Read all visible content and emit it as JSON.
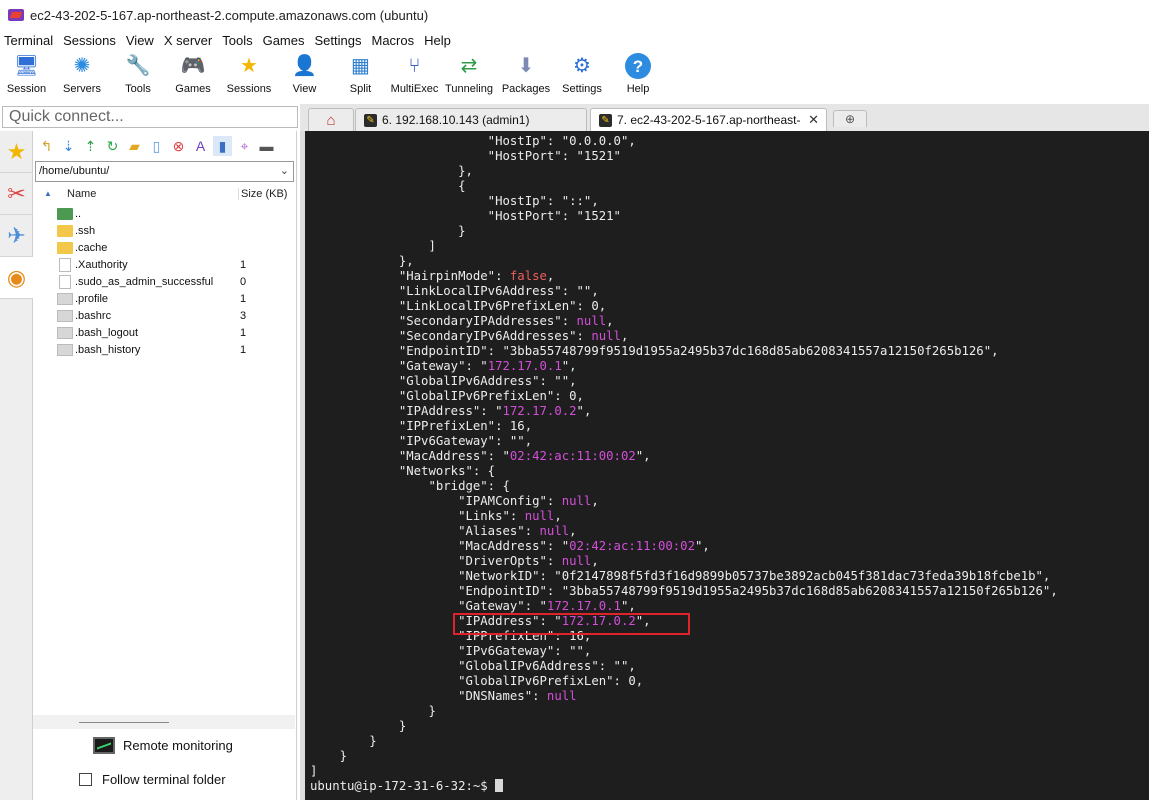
{
  "window": {
    "title": "ec2-43-202-5-167.ap-northeast-2.compute.amazonaws.com (ubuntu)"
  },
  "menu": [
    "Terminal",
    "Sessions",
    "View",
    "X server",
    "Tools",
    "Games",
    "Settings",
    "Macros",
    "Help"
  ],
  "toolbar": [
    {
      "label": "Session",
      "icon": "session-icon",
      "glyph": "🖥",
      "color": "#2f6fd6"
    },
    {
      "label": "Servers",
      "icon": "servers-icon",
      "glyph": "✺",
      "color": "#2b8be0"
    },
    {
      "label": "Tools",
      "icon": "tools-icon",
      "glyph": "🔧",
      "color": "#d33"
    },
    {
      "label": "Games",
      "icon": "games-icon",
      "glyph": "🎮",
      "color": "#555"
    },
    {
      "label": "Sessions",
      "icon": "star-icon",
      "glyph": "★",
      "color": "#f2b705"
    },
    {
      "label": "View",
      "icon": "view-icon",
      "glyph": "👤",
      "color": "#444"
    },
    {
      "label": "Split",
      "icon": "split-icon",
      "glyph": "▦",
      "color": "#2f7fd0"
    },
    {
      "label": "MultiExec",
      "icon": "multiexec-icon",
      "glyph": "⑂",
      "color": "#3b5bc4"
    },
    {
      "label": "Tunneling",
      "icon": "tunneling-icon",
      "glyph": "⇄",
      "color": "#2f9a4a"
    },
    {
      "label": "Packages",
      "icon": "packages-icon",
      "glyph": "⬇",
      "color": "#7a8ab5"
    },
    {
      "label": "Settings",
      "icon": "gear-icon",
      "glyph": "⚙",
      "color": "#2f6fd6"
    },
    {
      "label": "Help",
      "icon": "help-icon",
      "glyph": "?",
      "color": "#ffffff"
    }
  ],
  "quick_connect": {
    "placeholder": "Quick connect..."
  },
  "tabs": [
    {
      "label": "6. 192.168.10.143 (admin1)"
    },
    {
      "label": "7. ec2-43-202-5-167.ap-northeast-"
    }
  ],
  "browser": {
    "path": "/home/ubuntu/",
    "col_name": "Name",
    "col_size": "Size (KB)",
    "files": [
      {
        "name": "..",
        "size": "",
        "kind": "up"
      },
      {
        "name": ".ssh",
        "size": "",
        "kind": "folder"
      },
      {
        "name": ".cache",
        "size": "",
        "kind": "folder"
      },
      {
        "name": ".Xauthority",
        "size": "1",
        "kind": "doc"
      },
      {
        "name": ".sudo_as_admin_successful",
        "size": "0",
        "kind": "doc"
      },
      {
        "name": ".profile",
        "size": "1",
        "kind": "sh"
      },
      {
        "name": ".bashrc",
        "size": "3",
        "kind": "sh"
      },
      {
        "name": ".bash_logout",
        "size": "1",
        "kind": "sh"
      },
      {
        "name": ".bash_history",
        "size": "1",
        "kind": "sh"
      }
    ],
    "remote_monitoring": "Remote monitoring",
    "follow_folder": "Follow terminal folder"
  },
  "terminal": {
    "lines": [
      [
        [
          "                        \"HostIp\": \"0.0.0.0\",",
          ""
        ]
      ],
      [
        [
          "                        \"HostPort\": \"1521\"",
          ""
        ]
      ],
      [
        [
          "                    },",
          ""
        ]
      ],
      [
        [
          "                    {",
          ""
        ]
      ],
      [
        [
          "                        \"HostIp\": \"::\",",
          ""
        ]
      ],
      [
        [
          "                        \"HostPort\": \"1521\"",
          ""
        ]
      ],
      [
        [
          "                    }",
          ""
        ]
      ],
      [
        [
          "                ]",
          ""
        ]
      ],
      [
        [
          "            },",
          ""
        ]
      ],
      [
        [
          "            \"HairpinMode\": ",
          ""
        ],
        [
          "false",
          "bool"
        ],
        [
          ",",
          ""
        ]
      ],
      [
        [
          "            \"LinkLocalIPv6Address\": \"\",",
          ""
        ]
      ],
      [
        [
          "            \"LinkLocalIPv6PrefixLen\": 0,",
          ""
        ]
      ],
      [
        [
          "            \"SecondaryIPAddresses\": ",
          ""
        ],
        [
          "null",
          "null"
        ],
        [
          ",",
          ""
        ]
      ],
      [
        [
          "            \"SecondaryIPv6Addresses\": ",
          ""
        ],
        [
          "null",
          "null"
        ],
        [
          ",",
          ""
        ]
      ],
      [
        [
          "            \"EndpointID\": \"3bba55748799f9519d1955a2495b37dc168d85ab6208341557a12150f265b126\",",
          ""
        ]
      ],
      [
        [
          "            \"Gateway\": \"",
          ""
        ],
        [
          "172.17.0.1",
          "ip"
        ],
        [
          "\",",
          ""
        ]
      ],
      [
        [
          "            \"GlobalIPv6Address\": \"\",",
          ""
        ]
      ],
      [
        [
          "            \"GlobalIPv6PrefixLen\": 0,",
          ""
        ]
      ],
      [
        [
          "            \"IPAddress\": \"",
          ""
        ],
        [
          "172.17.0.2",
          "ip"
        ],
        [
          "\",",
          ""
        ]
      ],
      [
        [
          "            \"IPPrefixLen\": 16,",
          ""
        ]
      ],
      [
        [
          "            \"IPv6Gateway\": \"\",",
          ""
        ]
      ],
      [
        [
          "            \"MacAddress\": \"",
          ""
        ],
        [
          "02:42:ac:11:00:02",
          "ip"
        ],
        [
          "\",",
          ""
        ]
      ],
      [
        [
          "            \"Networks\": {",
          ""
        ]
      ],
      [
        [
          "                \"bridge\": {",
          ""
        ]
      ],
      [
        [
          "                    \"IPAMConfig\": ",
          ""
        ],
        [
          "null",
          "null"
        ],
        [
          ",",
          ""
        ]
      ],
      [
        [
          "                    \"Links\": ",
          ""
        ],
        [
          "null",
          "null"
        ],
        [
          ",",
          ""
        ]
      ],
      [
        [
          "                    \"Aliases\": ",
          ""
        ],
        [
          "null",
          "null"
        ],
        [
          ",",
          ""
        ]
      ],
      [
        [
          "                    \"MacAddress\": \"",
          ""
        ],
        [
          "02:42:ac:11:00:02",
          "ip"
        ],
        [
          "\",",
          ""
        ]
      ],
      [
        [
          "                    \"DriverOpts\": ",
          ""
        ],
        [
          "null",
          "null"
        ],
        [
          ",",
          ""
        ]
      ],
      [
        [
          "                    \"NetworkID\": \"0f2147898f5fd3f16d9899b05737be3892acb045f381dac73feda39b18fcbe1b\",",
          ""
        ]
      ],
      [
        [
          "                    \"EndpointID\": \"3bba55748799f9519d1955a2495b37dc168d85ab6208341557a12150f265b126\",",
          ""
        ]
      ],
      [
        [
          "                    \"Gateway\": \"",
          ""
        ],
        [
          "172.17.0.1",
          "ip"
        ],
        [
          "\",",
          ""
        ]
      ],
      [
        [
          "                    \"IPAddress\": \"",
          ""
        ],
        [
          "172.17.0.2",
          "ip"
        ],
        [
          "\",",
          ""
        ]
      ],
      [
        [
          "                    \"IPPrefixLen\": 16,",
          ""
        ]
      ],
      [
        [
          "                    \"IPv6Gateway\": \"\",",
          ""
        ]
      ],
      [
        [
          "                    \"GlobalIPv6Address\": \"\",",
          ""
        ]
      ],
      [
        [
          "                    \"GlobalIPv6PrefixLen\": 0,",
          ""
        ]
      ],
      [
        [
          "                    \"DNSNames\": ",
          ""
        ],
        [
          "null",
          "null"
        ]
      ],
      [
        [
          "                }",
          ""
        ]
      ],
      [
        [
          "            }",
          ""
        ]
      ],
      [
        [
          "        }",
          ""
        ]
      ],
      [
        [
          "    }",
          ""
        ]
      ],
      [
        [
          "]",
          ""
        ]
      ]
    ],
    "prompt": "ubuntu@ip-172-31-6-32:~$ "
  }
}
